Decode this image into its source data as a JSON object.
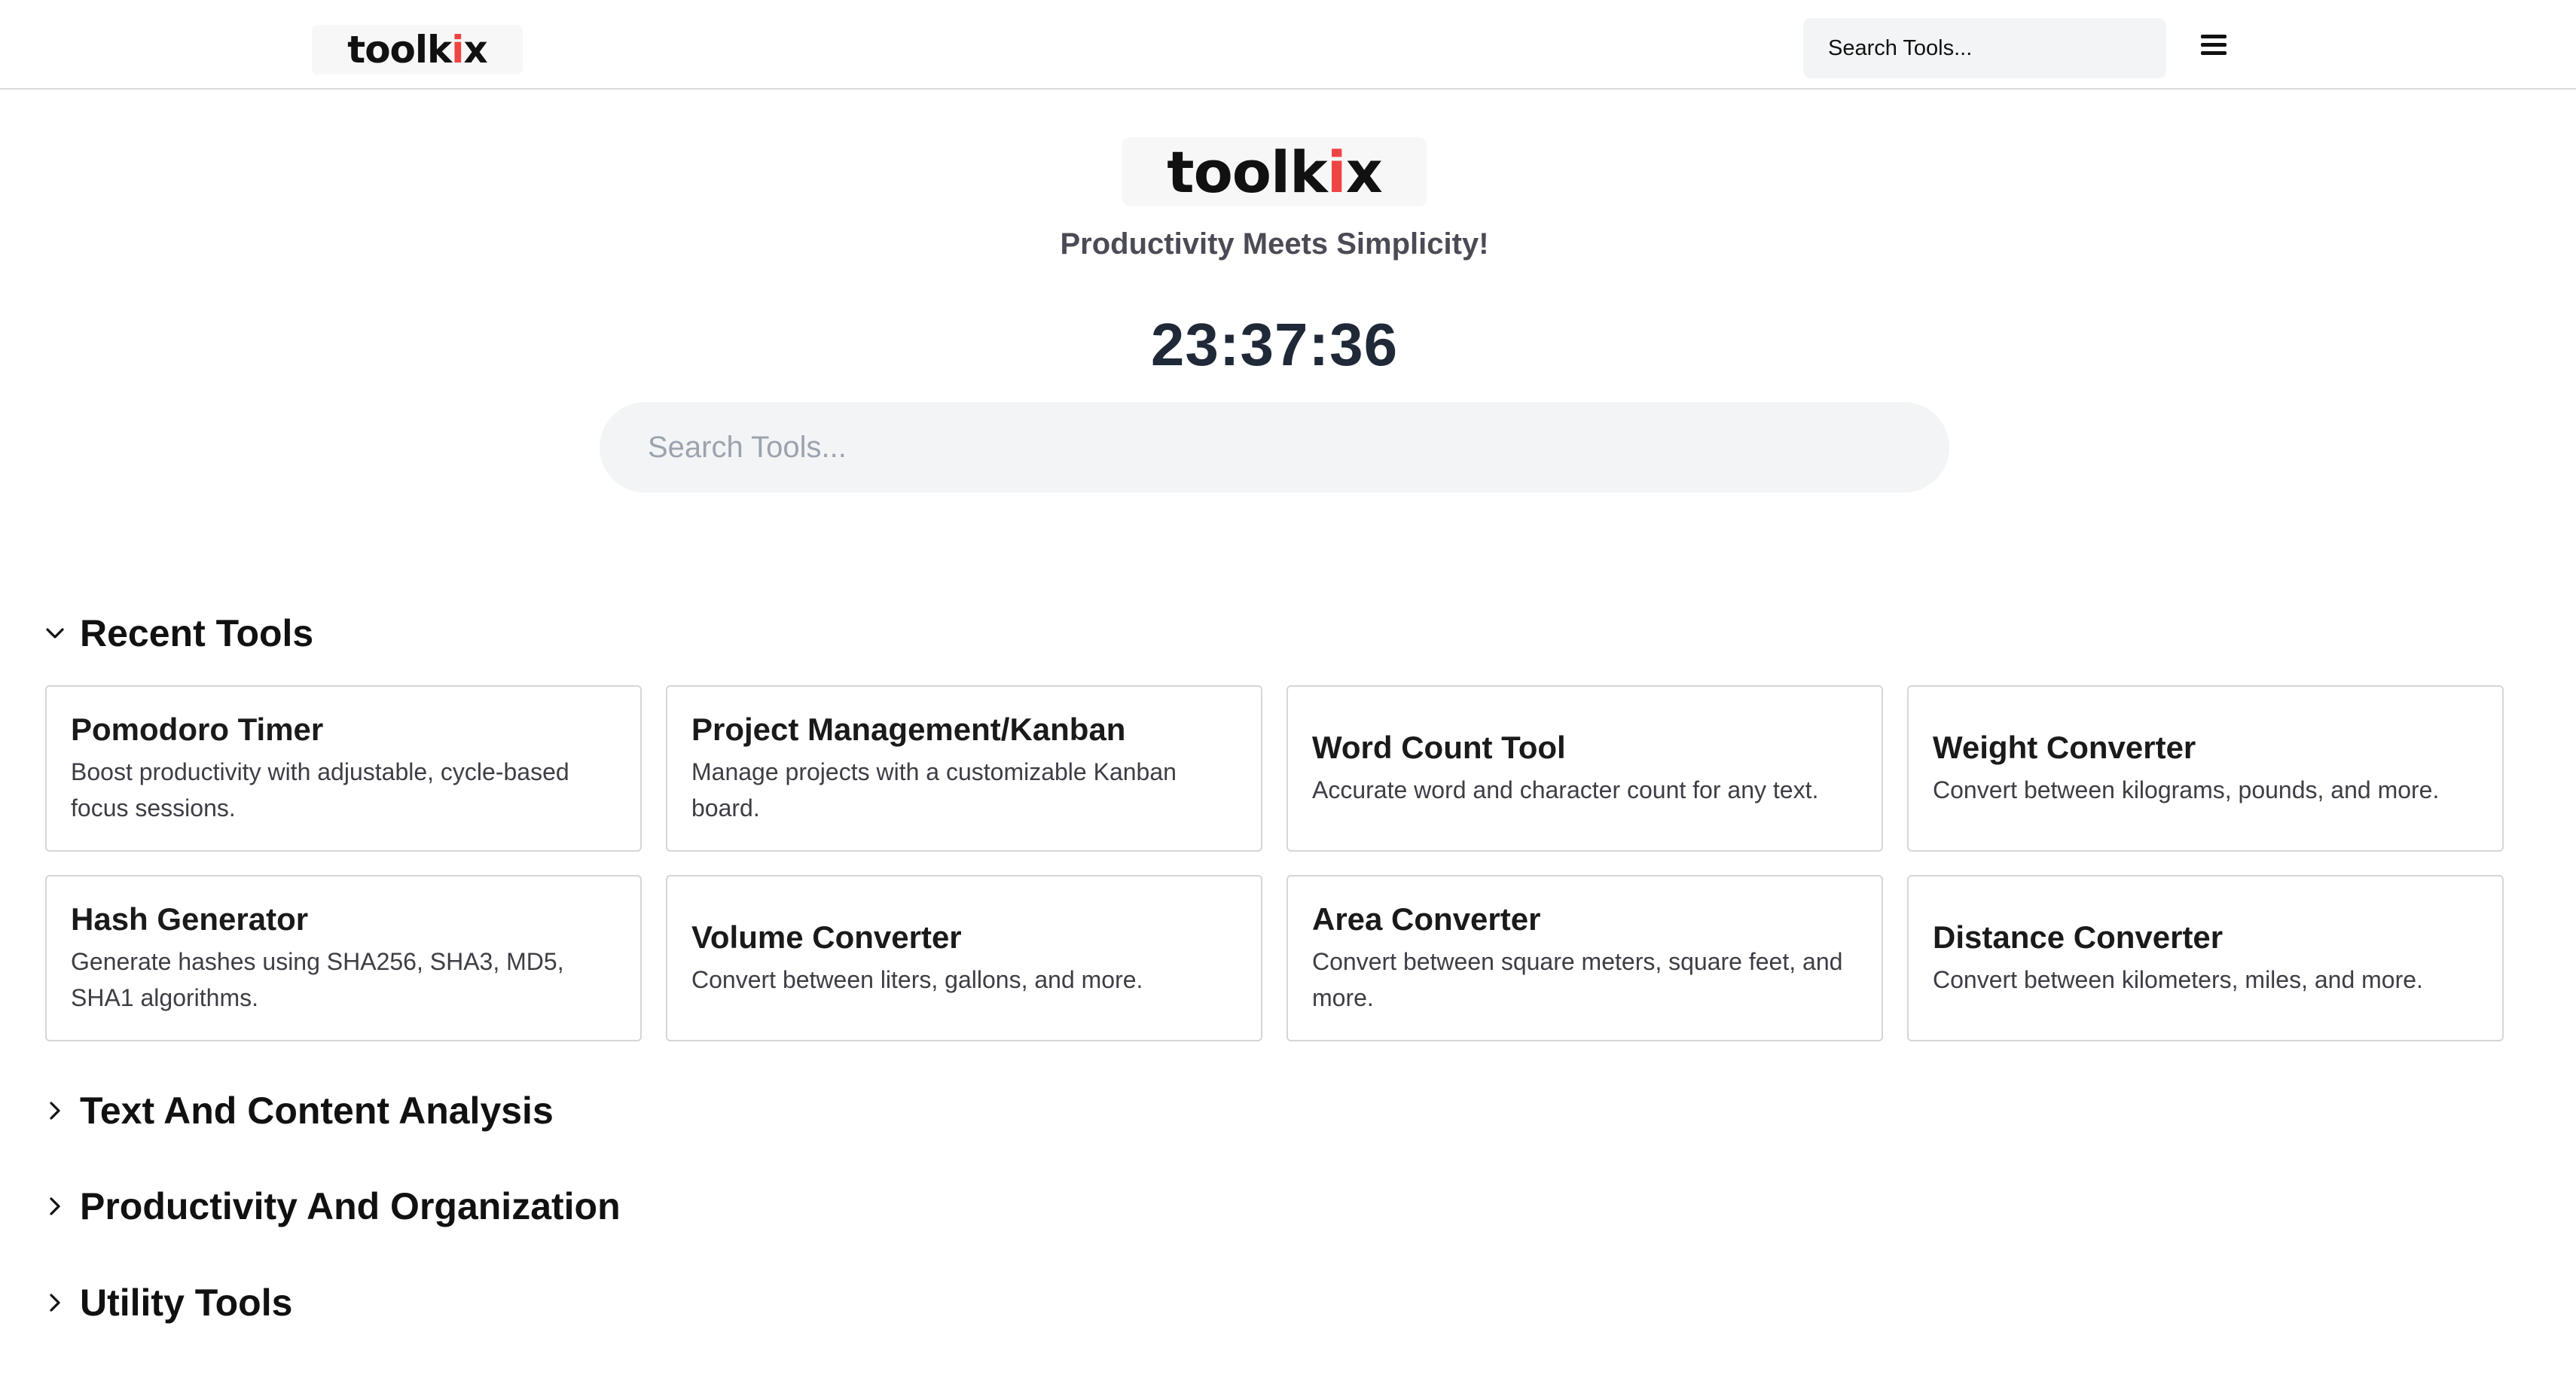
{
  "nav": {
    "logo": {
      "main": "toolk",
      "accent": "i",
      "tail": "x"
    },
    "search_placeholder": "Search Tools..."
  },
  "hero": {
    "logo": {
      "main": "toolk",
      "accent": "i",
      "tail": "x"
    },
    "tagline": "Productivity Meets Simplicity!",
    "clock": "23:37:36",
    "search_placeholder": "Search Tools..."
  },
  "sections": {
    "recent": {
      "title": "Recent Tools",
      "expanded": true,
      "icon": "chevron-down-icon"
    },
    "text": {
      "title": "Text And Content Analysis",
      "expanded": false,
      "icon": "chevron-right-icon"
    },
    "productivity": {
      "title": "Productivity And Organization",
      "expanded": false,
      "icon": "chevron-right-icon"
    },
    "utility": {
      "title": "Utility Tools",
      "expanded": false,
      "icon": "chevron-right-icon"
    }
  },
  "recent_tools": [
    {
      "title": "Pomodoro Timer",
      "desc": "Boost productivity with adjustable, cycle-based focus sessions."
    },
    {
      "title": "Project Management/Kanban",
      "desc": "Manage projects with a customizable Kanban board."
    },
    {
      "title": "Word Count Tool",
      "desc": "Accurate word and character count for any text."
    },
    {
      "title": "Weight Converter",
      "desc": "Convert between kilograms, pounds, and more."
    },
    {
      "title": "Hash Generator",
      "desc": "Generate hashes using SHA256, SHA3, MD5, SHA1 algorithms."
    },
    {
      "title": "Volume Converter",
      "desc": "Convert between liters, gallons, and more."
    },
    {
      "title": "Area Converter",
      "desc": "Convert between square meters, square feet, and more."
    },
    {
      "title": "Distance Converter",
      "desc": "Convert between kilometers, miles, and more."
    }
  ],
  "colors": {
    "accent": "#ef4444",
    "search_bg": "#f3f4f6",
    "card_border": "#d6d6d6",
    "tagline": "#4b4b55"
  }
}
